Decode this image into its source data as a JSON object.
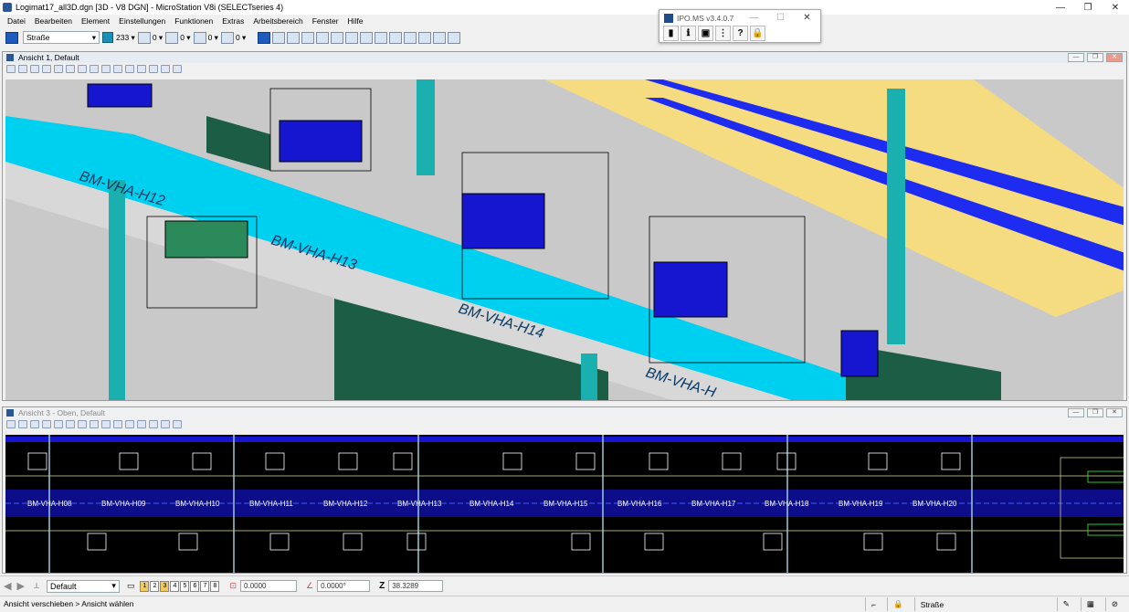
{
  "window": {
    "title": "Logimat17_all3D.dgn [3D - V8 DGN] - MicroStation V8i (SELECTseries 4)",
    "min": "—",
    "max": "❐",
    "close": "✕"
  },
  "menu": [
    "Datei",
    "Bearbeiten",
    "Element",
    "Einstellungen",
    "Funktionen",
    "Extras",
    "Arbeitsbereich",
    "Fenster",
    "Hilfe"
  ],
  "toolbar": {
    "level": "Straße",
    "color_index": "233",
    "weight1": "0",
    "weight2": "0",
    "style": "0",
    "transparency": "0"
  },
  "ipo": {
    "title": "IPO.MS v3.4.0.7",
    "tools": [
      "▮",
      "ℹ",
      "▣",
      "⋮",
      "?",
      "🔒"
    ]
  },
  "view1": {
    "title": "Ansicht 1, Default",
    "labels": [
      "BM-VHA-H12",
      "BM-VHA-H13",
      "BM-VHA-H14",
      "BM-VHA-H"
    ]
  },
  "view3": {
    "title": "Ansicht 3 - Oben, Default",
    "labels": [
      "BM-VHA-H08",
      "BM-VHA-H09",
      "BM-VHA-H10",
      "BM-VHA-H11",
      "BM-VHA-H12",
      "BM-VHA-H13",
      "BM-VHA-H14",
      "BM-VHA-H15",
      "BM-VHA-H16",
      "BM-VHA-H17",
      "BM-VHA-H18",
      "BM-VHA-H19",
      "BM-VHA-H20"
    ]
  },
  "status": {
    "view_combo": "Default",
    "views": [
      "1",
      "2",
      "3",
      "4",
      "5",
      "6",
      "7",
      "8"
    ],
    "active_views": [
      "1",
      "3"
    ],
    "x_field": "0.0000",
    "angle_field": "0.0000°",
    "z_label": "Z",
    "z_value": "38.3289"
  },
  "message": {
    "text": "Ansicht verschieben > Ansicht wählen",
    "level": "Straße"
  }
}
